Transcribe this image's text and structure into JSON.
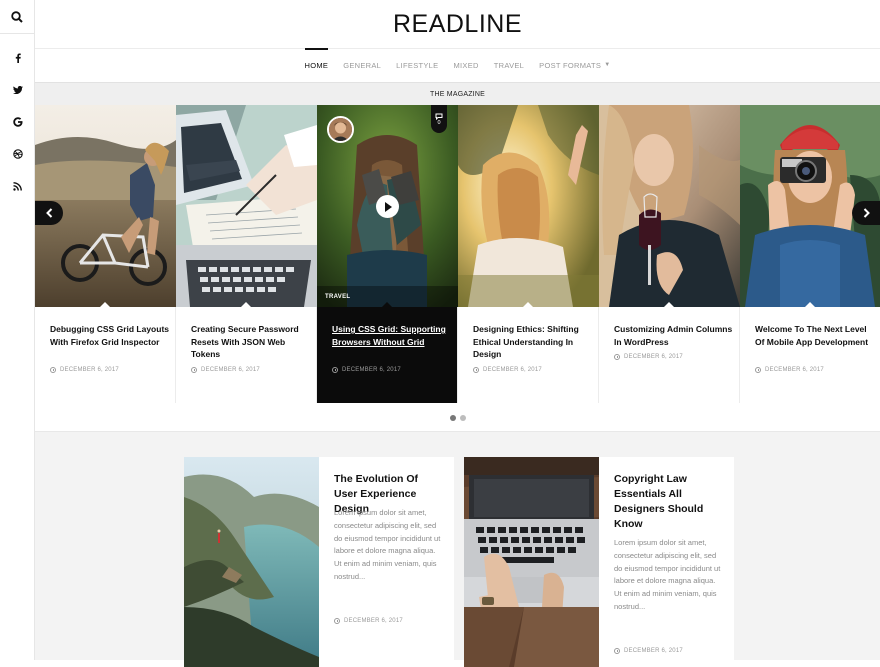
{
  "site": {
    "title": "READLINE"
  },
  "sidebar": {
    "icons": [
      "search-icon",
      "facebook-icon",
      "twitter-icon",
      "google-icon",
      "dribbble-icon",
      "rss-icon"
    ]
  },
  "nav": {
    "items": [
      {
        "label": "HOME",
        "active": true
      },
      {
        "label": "GENERAL"
      },
      {
        "label": "LIFESTYLE"
      },
      {
        "label": "MIXED"
      },
      {
        "label": "TRAVEL"
      },
      {
        "label": "POST FORMATS"
      }
    ]
  },
  "magazine_bar": {
    "label": "THE MAGAZINE"
  },
  "slides": [
    {
      "title": "Debugging CSS Grid Layouts With Firefox Grid Inspector",
      "date": "DECEMBER 6, 2017"
    },
    {
      "title": "Creating Secure Password Resets With JSON Web Tokens",
      "date": "DECEMBER 6, 2017"
    },
    {
      "title": "Using CSS Grid: Supporting Browsers Without Grid",
      "date": "DECEMBER 6, 2017",
      "category": "TRAVEL",
      "comments": "0"
    },
    {
      "title": "Designing Ethics: Shifting Ethical Understanding In Design",
      "date": "DECEMBER 6, 2017"
    },
    {
      "title": "Customizing Admin Columns In WordPress",
      "date": "DECEMBER 6, 2017"
    },
    {
      "title": "Welcome To The Next Level Of Mobile App Development",
      "date": "DECEMBER 6, 2017"
    }
  ],
  "pagination": {
    "count": 2,
    "active": 0
  },
  "cards": [
    {
      "title": "The Evolution Of User Experience Design",
      "excerpt": "Lorem ipsum dolor sit amet, consectetur adipiscing elit, sed do eiusmod tempor incididunt ut labore et dolore magna aliqua. Ut enim ad minim veniam, quis nostrud...",
      "date": "DECEMBER 6, 2017"
    },
    {
      "title": "Copyright Law Essentials All Designers Should Know",
      "excerpt": "Lorem ipsum dolor sit amet, consectetur adipiscing elit, sed do eiusmod tempor incididunt ut labore et dolore magna aliqua. Ut enim ad minim veniam, quis nostrud...",
      "date": "DECEMBER 6, 2017"
    }
  ]
}
